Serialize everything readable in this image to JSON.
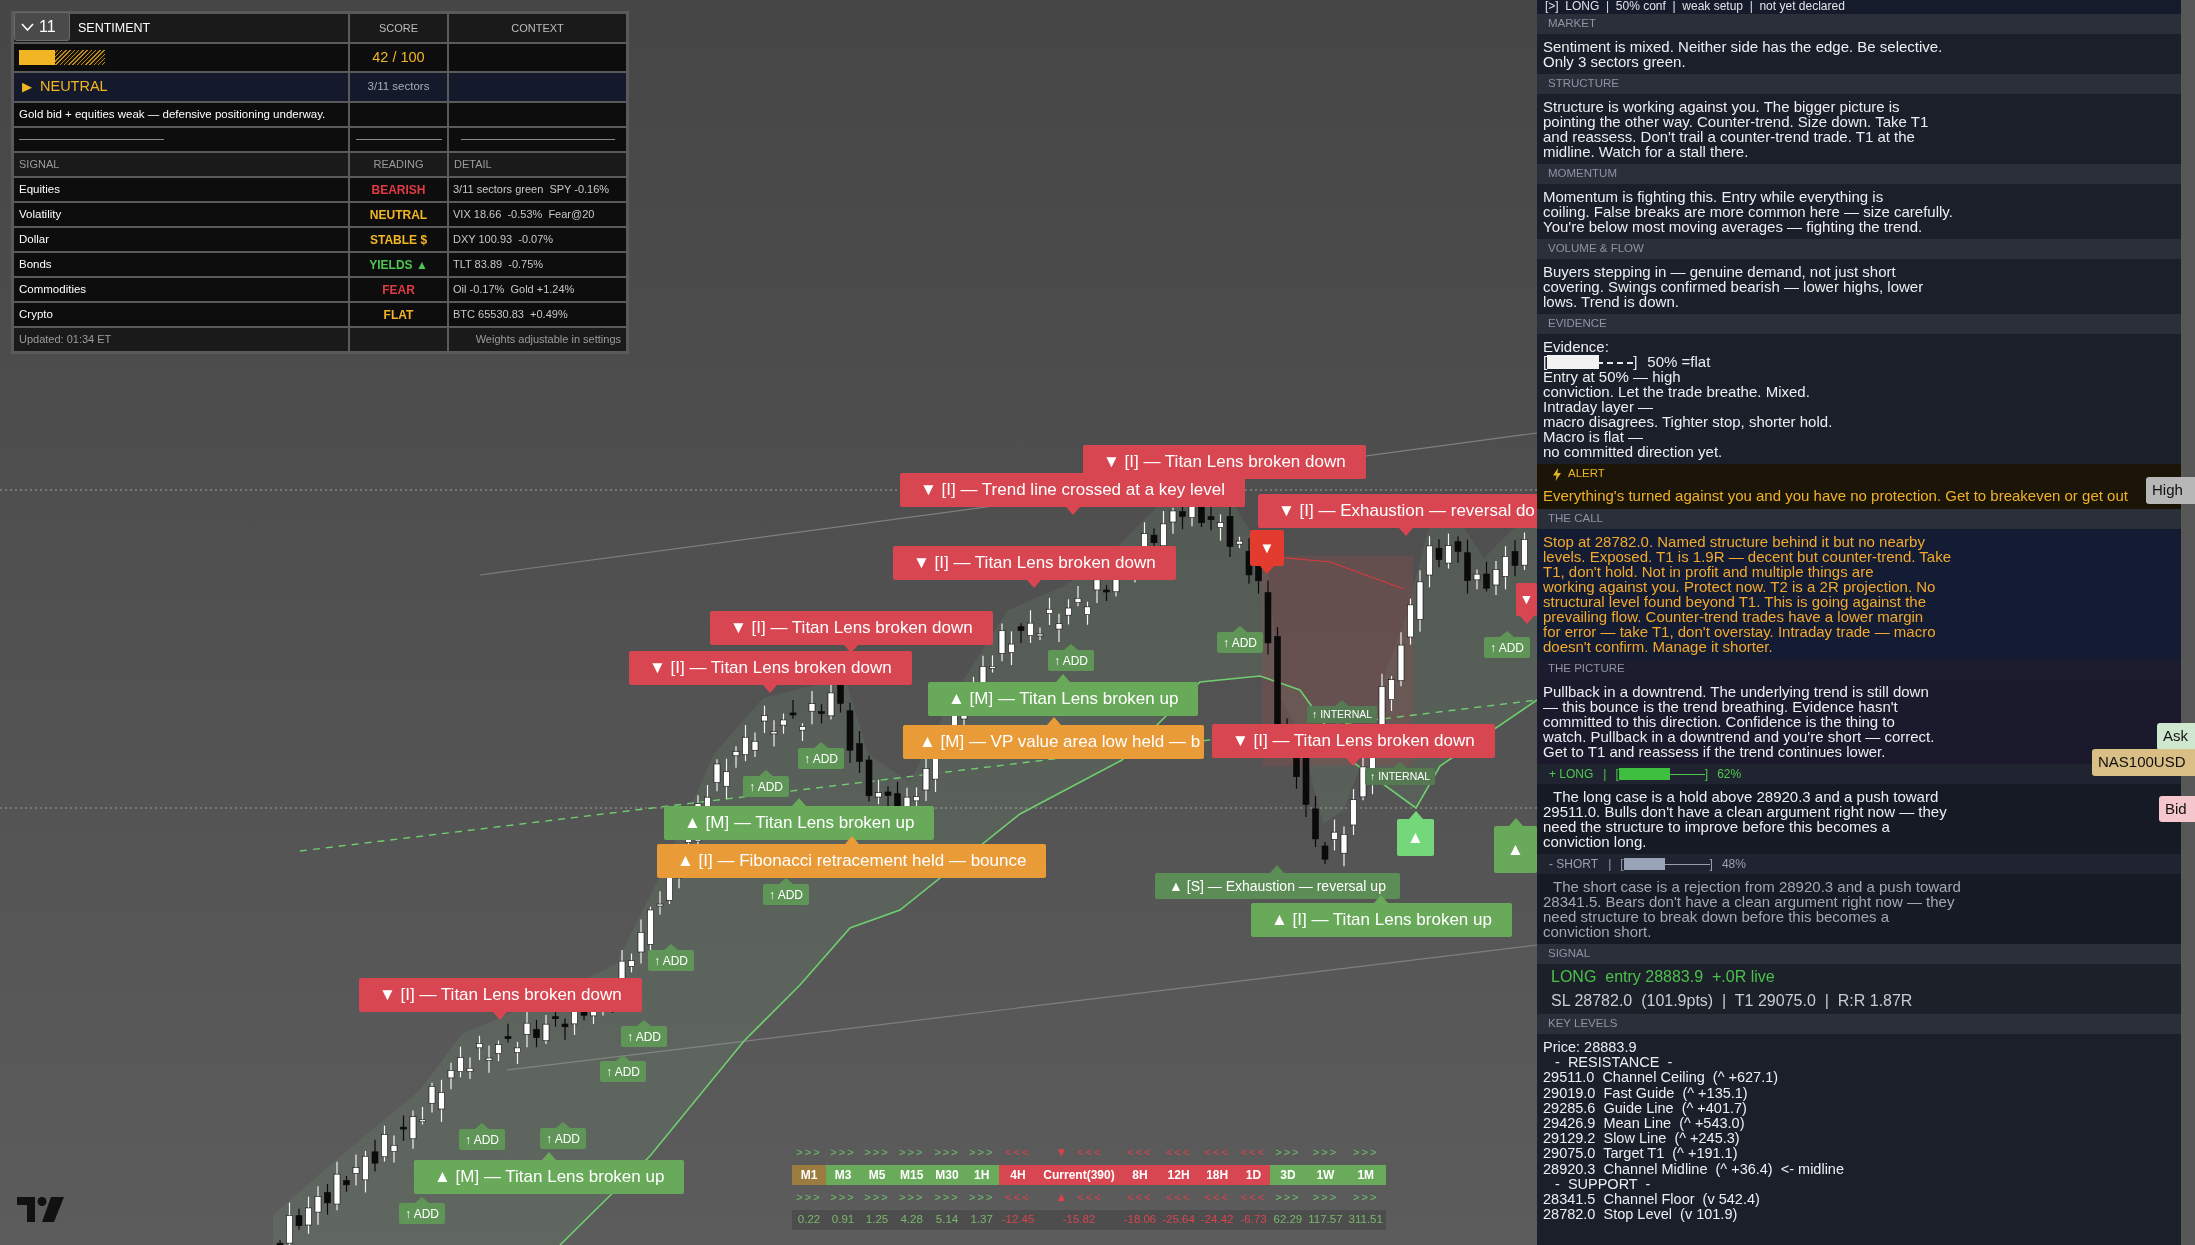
{
  "sentiment_table": {
    "title": "SENTIMENT",
    "collapse_button": {
      "count": "11"
    },
    "header_columns": [
      "SCORE",
      "CONTEXT"
    ],
    "gauge": {
      "level": 0.42
    },
    "score": "42 / 100",
    "verdict": {
      "marker": "▶",
      "text": "NEUTRAL",
      "color": "#f2b624",
      "sectors": "3/11 sectors"
    },
    "summary": "Gold bid + equities weak — defensive positioning underway.",
    "signal_columns": [
      "SIGNAL",
      "READING",
      "DETAIL"
    ],
    "signals": [
      {
        "signal": "Equities",
        "reading": "BEARISH",
        "color": "#e23a45",
        "detail": "3/11 sectors green  SPY -0.16%"
      },
      {
        "signal": "Volatility",
        "reading": "NEUTRAL",
        "color": "#f2b624",
        "detail": "VIX 18.66  -0.53%  Fear@20"
      },
      {
        "signal": "Dollar",
        "reading": "STABLE $",
        "color": "#f2b624",
        "detail": "DXY 100.93  -0.07%"
      },
      {
        "signal": "Bonds",
        "reading": "YIELDS ▲",
        "color": "#4cc552",
        "detail": "TLT 83.89  -0.75%"
      },
      {
        "signal": "Commodities",
        "reading": "FEAR",
        "color": "#e23a45",
        "detail": "Oil -0.17%  Gold +1.24%"
      },
      {
        "signal": "Crypto",
        "reading": "FLAT",
        "color": "#f2b624",
        "detail": "BTC 65530.83  +0.49%"
      }
    ],
    "updated": "Updated: 01:34 ET",
    "footnote": "Weights adjustable in settings"
  },
  "chart": {
    "labels": [
      {
        "text": "▼ [I] — Titan Lens broken down",
        "kind": "bearish"
      },
      {
        "text": "▼ [I] — Trend line crossed at a key level",
        "kind": "bearish"
      },
      {
        "text": "▼ [I] — Exhaustion — reversal do",
        "kind": "bearish"
      },
      {
        "text": "▼ [I] — Titan Lens broken down",
        "kind": "bearish"
      },
      {
        "text": "▼ [I] — Titan Lens broken down",
        "kind": "bearish"
      },
      {
        "text": "▼ [I] — Titan Lens broken down",
        "kind": "bearish"
      },
      {
        "text": "▲ [M] — Titan Lens broken up",
        "kind": "bullish"
      },
      {
        "text": "▲ [M] — VP value area low held — b",
        "kind": "level"
      },
      {
        "text": "▼ [I] — Titan Lens broken down",
        "kind": "bearish"
      },
      {
        "text": "▲ [M] — Titan Lens broken up",
        "kind": "bullish"
      },
      {
        "text": "▲ [I] — Fibonacci retracement held — bounce",
        "kind": "level"
      },
      {
        "text": "▲ [S] — Exhaustion — reversal up",
        "kind": "minor"
      },
      {
        "text": "▲ [I] — Titan Lens broken up",
        "kind": "bullish"
      },
      {
        "text": "▼ [I] — Titan Lens broken down",
        "kind": "bearish"
      },
      {
        "text": "▲ [M] — Titan Lens broken up",
        "kind": "bullish"
      },
      {
        "text": "▼",
        "kind": "trigger"
      },
      {
        "text": "▲",
        "kind": "signal"
      },
      {
        "text": "▲",
        "kind": "bullish"
      },
      {
        "text": "▼",
        "kind": "bearish"
      }
    ],
    "markers": [
      {
        "text": "↑ ADD",
        "kind": "add"
      },
      {
        "text": "↑ ADD",
        "kind": "add"
      },
      {
        "text": "↑ ADD",
        "kind": "add"
      },
      {
        "text": "↑ ADD",
        "kind": "add"
      },
      {
        "text": "↑ ADD",
        "kind": "add"
      },
      {
        "text": "↑ ADD",
        "kind": "add"
      },
      {
        "text": "↑ ADD",
        "kind": "add"
      },
      {
        "text": "↑ ADD",
        "kind": "add"
      },
      {
        "text": "↑ ADD",
        "kind": "add"
      },
      {
        "text": "↑ ADD",
        "kind": "add"
      },
      {
        "text": "↑ ADD",
        "kind": "add"
      },
      {
        "text": "↑ ADD",
        "kind": "add"
      },
      {
        "text": "↑ INTERNAL",
        "kind": "internal"
      },
      {
        "text": "↑ INTERNAL",
        "kind": "internal"
      }
    ]
  },
  "timeframe_strip": {
    "timeframes": [
      {
        "label": "M1",
        "color": "#9b7b3f",
        "kind": "up",
        "arrows_top": ">>>",
        "arrows_bottom": ">>>",
        "value": "0.22"
      },
      {
        "label": "M3",
        "color": "#6aab5b",
        "kind": "up",
        "arrows_top": ">>>",
        "arrows_bottom": ">>>",
        "value": "0.91"
      },
      {
        "label": "M5",
        "color": "#6aab5b",
        "kind": "up",
        "arrows_top": ">>>",
        "arrows_bottom": ">>>",
        "value": "1.25"
      },
      {
        "label": "M15",
        "color": "#6aab5b",
        "kind": "up",
        "arrows_top": ">>>",
        "arrows_bottom": ">>>",
        "value": "4.28"
      },
      {
        "label": "M30",
        "color": "#6aab5b",
        "kind": "up",
        "arrows_top": ">>>",
        "arrows_bottom": ">>>",
        "value": "5.14"
      },
      {
        "label": "1H",
        "color": "#6aab5b",
        "kind": "up",
        "arrows_top": ">>>",
        "arrows_bottom": ">>>",
        "value": "1.37"
      },
      {
        "label": "4H",
        "color": "#d84651",
        "kind": "down",
        "arrows_top": "<<<",
        "arrows_bottom": "<<<",
        "value": "-12.45"
      },
      {
        "label": "Current(390)",
        "color": "#d84651",
        "kind": "down",
        "marker_top": "▼",
        "marker_bottom": "▲",
        "arrows_top": "<<<",
        "arrows_bottom": "<<<",
        "value": "-15.82"
      },
      {
        "label": "8H",
        "color": "#d84651",
        "kind": "down",
        "arrows_top": "<<<",
        "arrows_bottom": "<<<",
        "value": "-18.06"
      },
      {
        "label": "12H",
        "color": "#d84651",
        "kind": "down",
        "arrows_top": "<<<",
        "arrows_bottom": "<<<",
        "value": "-25.64"
      },
      {
        "label": "18H",
        "color": "#d84651",
        "kind": "down",
        "arrows_top": "<<<",
        "arrows_bottom": "<<<",
        "value": "-24.42"
      },
      {
        "label": "1D",
        "color": "#d84651",
        "kind": "down",
        "arrows_top": "<<<",
        "arrows_bottom": "<<<",
        "value": "-6.73"
      },
      {
        "label": "3D",
        "color": "#6aab5b",
        "kind": "up",
        "arrows_top": ">>>",
        "arrows_bottom": ">>>",
        "value": "62.29"
      },
      {
        "label": "1W",
        "color": "#6aab5b",
        "kind": "up",
        "arrows_top": ">>>",
        "arrows_bottom": ">>>",
        "value": "117.57"
      },
      {
        "label": "1M",
        "color": "#6aab5b",
        "kind": "up",
        "arrows_top": ">>>",
        "arrows_bottom": ">>>",
        "value": "311.51"
      }
    ]
  },
  "analysis_panel": {
    "status_line": "[>]  LONG  |  50% conf  |  weak setup  |  not yet declared",
    "sections": [
      {
        "kind": "text",
        "title": "MARKET",
        "body": "Sentiment is mixed. Neither side has the edge. Be selective.\nOnly 3 sectors green."
      },
      {
        "kind": "text",
        "title": "STRUCTURE",
        "body": "Structure is working against you. The bigger picture is\npointing the other way. Counter-trend. Size down. Take T1\nand reassess. Don't trail a counter-trend trade. T1 at the\nmidline. Watch for a stall there."
      },
      {
        "kind": "text",
        "title": "MOMENTUM",
        "body": "Momentum is fighting this. Entry while everything is\ncoiling. False breaks are more common here — size carefully.\nYou're below most moving averages — fighting the trend."
      },
      {
        "kind": "text",
        "title": "VOLUME & FLOW",
        "body": "Buyers stepping in — genuine demand, not just short\ncovering. Swings confirmed bearish — lower highs, lower\nlows. Trend is down."
      },
      {
        "kind": "evidence",
        "title": "EVIDENCE",
        "heading": "Evidence:",
        "meter": {
          "open": "[",
          "level": 0.6,
          "close": "]",
          "reading": "50% =flat"
        },
        "body": "Entry at 50% — high\nconviction. Let the trade breathe.  Mixed.\nIntraday layer —\nmacro disagrees. Tighter stop, shorter hold.\nMacro is flat —\nno committed direction yet."
      },
      {
        "kind": "alert",
        "title": "ALERT",
        "body": "Everything's turned against you and you have no protection. Get to breakeven or get out"
      },
      {
        "kind": "call",
        "title": "THE CALL",
        "body": "Stop at 28782.0. Named structure behind it but no nearby\nlevels. Exposed. T1 is 1.9R — decent but counter-trend. Take\nT1, don't hold. Not in profit and multiple things are\nworking against you. Protect now. T2 is a 2R projection. No\nstructural level found beyond T1. This is going against the\nprevailing flow. Counter-trend trades have a lower margin\nfor error — take T1, don't overstay. Intraday trade — macro\ndoesn't confirm. Manage it shorter."
      },
      {
        "kind": "picture",
        "title": "THE PICTURE",
        "body": "Pullback in a downtrend. The underlying trend is still down\n— this bounce is the trend breathing. Evidence hasn't\ncommitted to this direction. Confidence is the thing to\nwatch. Pullback in a downtrend and you're short — correct.\nGet to T1 and reassess if the trend continues lower.",
        "cases": [
          {
            "kind": "long",
            "label": "+ LONG",
            "separator": "|",
            "open": "[",
            "level": 0.6,
            "close": "]",
            "reading": "62%",
            "body": "The long case is a hold above 28920.3 and a push toward\n29511.0. Bulls don't have a clean argument right now — they\nneed the structure to improve before this becomes a\nconviction long."
          },
          {
            "kind": "short",
            "label": "- SHORT",
            "separator": "|",
            "open": "[",
            "level": 0.48,
            "close": "]",
            "reading": "48%",
            "body": "The short case is a rejection from 28920.3 and a push toward\n28341.5. Bears don't have a clean argument right now — they\nneed structure to break down before this becomes a\nconviction short."
          }
        ]
      },
      {
        "kind": "signal",
        "title": "SIGNAL",
        "entry": {
          "kind": "long",
          "text": "LONG  entry 28883.9  +.0R live"
        },
        "details": "SL 28782.0  (101.9pts)  |  T1 29075.0  |  R:R 1.87R"
      },
      {
        "kind": "levels",
        "title": "KEY LEVELS",
        "lines": [
          {
            "kind": "price",
            "text": "Price: 28883.9"
          },
          {
            "kind": "heading",
            "text": "-  RESISTANCE  -"
          },
          {
            "kind": "level",
            "text": "29511.0  Channel Ceiling  (^ +627.1)"
          },
          {
            "kind": "level",
            "text": "29019.0  Fast Guide  (^ +135.1)"
          },
          {
            "kind": "level",
            "text": "29285.6  Guide Line  (^ +401.7)"
          },
          {
            "kind": "level",
            "text": "29426.9  Mean Line  (^ +543.0)"
          },
          {
            "kind": "level",
            "text": "29129.2  Slow Line  (^ +245.3)"
          },
          {
            "kind": "level",
            "text": "29075.0  Target T1  (^ +191.1)"
          },
          {
            "kind": "level",
            "text": "28920.3  Channel Midline  (^ +36.4)  <- midline"
          },
          {
            "kind": "heading",
            "text": "-  SUPPORT  -"
          },
          {
            "kind": "level",
            "text": "28341.5  Channel Floor  (v 542.4)"
          },
          {
            "kind": "level",
            "text": "28782.0  Stop Level  (v 101.9)"
          }
        ]
      }
    ]
  },
  "price_tags": [
    {
      "text": "High",
      "kind": "high"
    },
    {
      "text": "Ask",
      "kind": "ask"
    },
    {
      "text": "NAS100USD",
      "kind": "symbol"
    },
    {
      "text": "Bid",
      "kind": "bid"
    }
  ]
}
